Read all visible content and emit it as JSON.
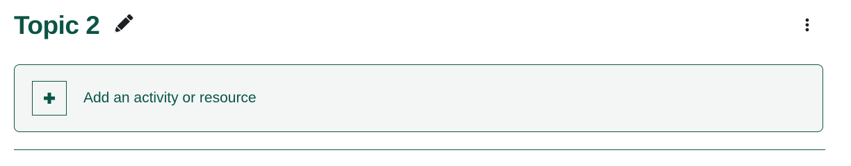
{
  "section": {
    "title": "Topic 2",
    "edit_icon": "pencil-icon",
    "menu_icon": "kebab-vertical-icon"
  },
  "add_activity": {
    "label": "Add an activity or resource",
    "icon": "plus-icon"
  },
  "colors": {
    "primary": "#0b5446",
    "box_background": "#f3f6f5",
    "icon_dark": "#1d2125"
  }
}
